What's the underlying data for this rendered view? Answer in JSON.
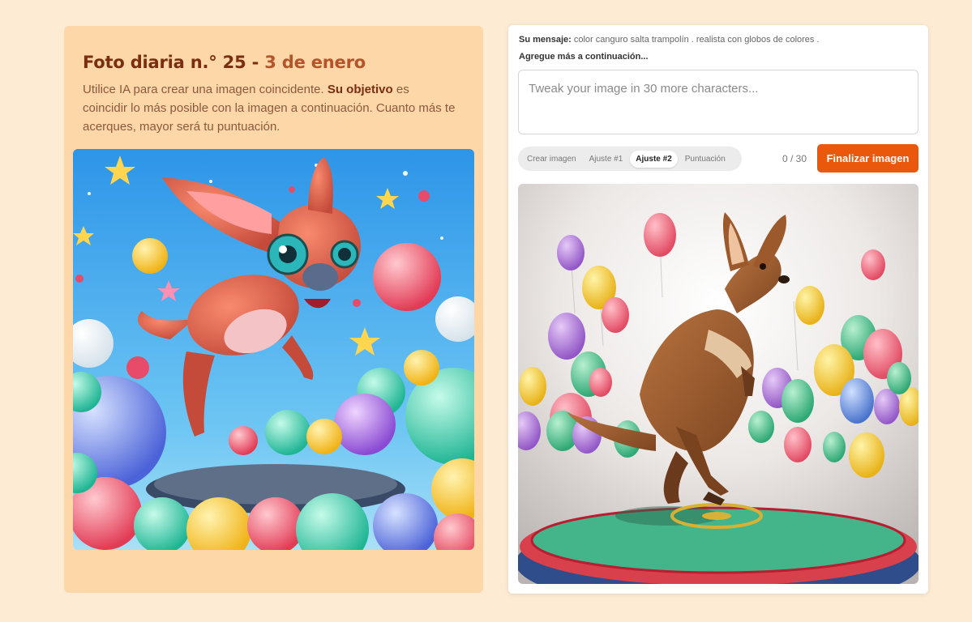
{
  "challenge": {
    "title": "Foto diaria n.° 25 - ",
    "date": "3 de enero",
    "intro_pre": "Utilice IA para crear una imagen coincidente. ",
    "intro_bold": "Su objetivo",
    "intro_post": " es coincidir lo más posible con la imagen a continuación. Cuanto más te acerques, mayor será tu puntuación."
  },
  "editor": {
    "message_label": "Su mensaje:",
    "message_text": "color canguro salta trampolín . realista con globos de colores .",
    "add_more": "Agregue más a continuación...",
    "placeholder": "Tweak your image in 30 more characters...",
    "tabs": [
      {
        "label": "Crear imagen"
      },
      {
        "label": "Ajuste #1"
      },
      {
        "label": "Ajuste #2"
      },
      {
        "label": "Puntuación"
      }
    ],
    "active_tab": "Ajuste #2",
    "counter": "0 / 30",
    "finalize_label": "Finalizar imagen"
  },
  "images": {
    "target_icon": "cartoon-kangaroo-image",
    "generated_icon": "realistic-kangaroo-image"
  },
  "colors": {
    "accent": "#ea580c",
    "left_card_bg": "#fdd7a8",
    "page_bg": "#fdebd3",
    "title_color": "#7a2e10"
  }
}
